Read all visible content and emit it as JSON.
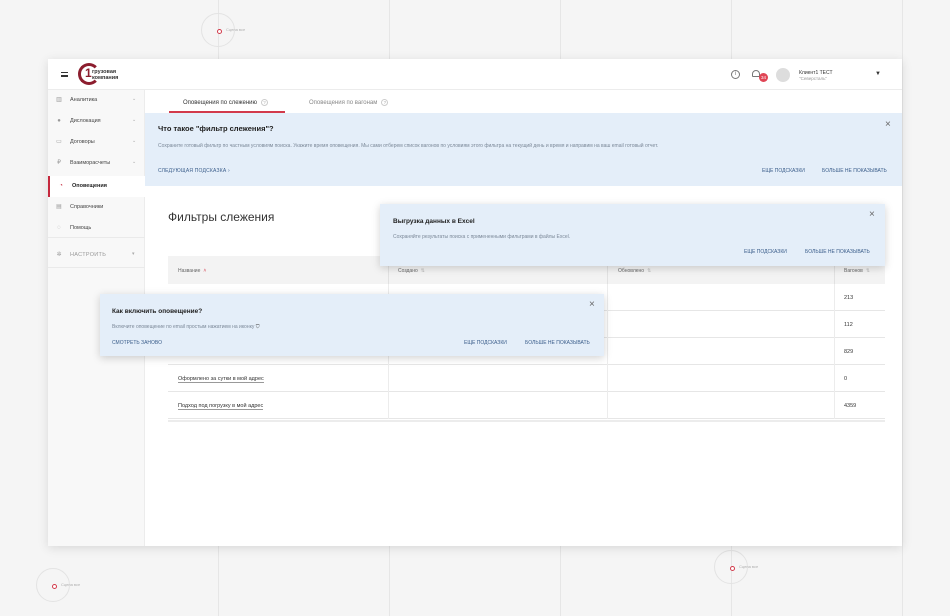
{
  "background": {
    "marker_label": "Сцена все"
  },
  "header": {
    "logo_number": "1",
    "logo_line1": "грузовая",
    "logo_line2": "компания",
    "info_icon": "info-icon",
    "notification_count": "34",
    "user_name": "Клиент1 ТЕСТ",
    "user_org": "\"Северсталь\""
  },
  "sidebar": {
    "items": [
      {
        "label": "Аналитика",
        "icon": "chart-icon"
      },
      {
        "label": "Дислокация",
        "icon": "location-pin-icon"
      },
      {
        "label": "Договоры",
        "icon": "folder-icon"
      },
      {
        "label": "Взаиморасчеты",
        "icon": "ruble-icon"
      },
      {
        "label": "Оповещения",
        "icon": "bell-icon"
      },
      {
        "label": "Справочники",
        "icon": "book-icon"
      },
      {
        "label": "Помощь",
        "icon": "help-icon"
      },
      {
        "label": "НАСТРОИТЬ",
        "icon": "gear-icon"
      }
    ]
  },
  "tabs": [
    {
      "label": "Оповещения по слежению",
      "active": true
    },
    {
      "label": "Оповещения по вагонам",
      "active": false
    }
  ],
  "hint_banner": {
    "title": "Что такое \"фильтр слежения\"?",
    "text": "Сохраните готовый фильтр по частным условиям поиска. Укажите время оповещения. Мы сами отберем список вагонов по условиям этого фильтра на текущий день и время и направим на ваш email готовый отчет.",
    "next_hint": "СЛЕДУЮЩАЯ ПОДСКАЗКА",
    "more_hints": "ЕЩЕ ПОДСКАЗКИ",
    "never_show": "БОЛЬШЕ НЕ ПОКАЗЫВАТЬ"
  },
  "page_title": "Фильтры слежения",
  "table": {
    "columns": [
      "Название",
      "Создано",
      "Обновлено",
      "Вагонов"
    ],
    "rows": [
      {
        "name": "",
        "count": "213"
      },
      {
        "name": "",
        "count": "112"
      },
      {
        "name": "",
        "count": "829"
      },
      {
        "name": "Оформлено за сутки в мой адрес",
        "count": "0"
      },
      {
        "name": "Подход под погрузку в мой адрес",
        "count": "4359"
      }
    ]
  },
  "excel_popover": {
    "title": "Выгрузка данных в Excel",
    "text": "Сохраняйте результаты поиска с примененными фильтрами в файлы Excel.",
    "more_hints": "ЕЩЕ ПОДСКАЗКИ",
    "never_show": "БОЛЬШЕ НЕ ПОКАЗЫВАТЬ"
  },
  "alert_popover": {
    "title": "Как включить оповещение?",
    "text": "Включите оповещение по email простым нажатием на иконку",
    "icon": "notification-toggle-icon",
    "watch_again": "СМОТРЕТЬ ЗАНОВО",
    "more_hints": "ЕЩЕ ПОДСКАЗКИ",
    "never_show": "БОЛЬШЕ НЕ ПОКАЗЫВАТЬ"
  }
}
